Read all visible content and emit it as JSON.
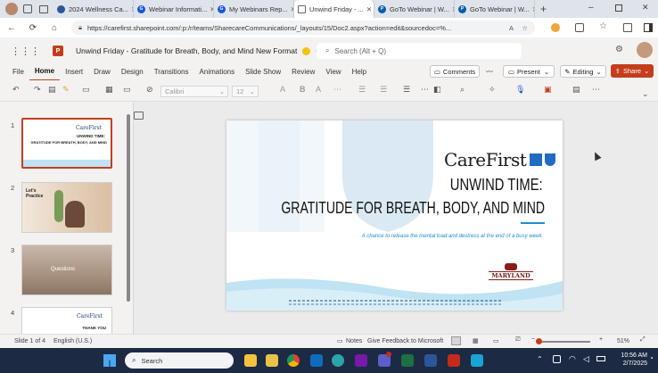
{
  "browser": {
    "tabs": [
      {
        "label": "2024 Wellness Ca...",
        "color": "#2b579a"
      },
      {
        "label": "Webinar Informati...",
        "color": "#1a56db"
      },
      {
        "label": "My Webinars Rep...",
        "color": "#1a56db"
      },
      {
        "label": "Unwind Friday - ...",
        "color": "#c43e1c",
        "active": true
      },
      {
        "label": "GoTo Webinar | W...",
        "color": "#0b5cad"
      },
      {
        "label": "GoTo Webinar | W...",
        "color": "#0b5cad"
      }
    ],
    "url": "https://carefirst.sharepoint.com/:p:/r/teams/SharecareCommunications/_layouts/15/Doc2.aspx?action=edit&sourcedoc=%..."
  },
  "ppt": {
    "doc_title": "Unwind Friday - Gratitude for Breath, Body, and Mind New Format",
    "search_placeholder": "Search (Alt + Q)",
    "menu": [
      "File",
      "Home",
      "Insert",
      "Draw",
      "Design",
      "Transitions",
      "Animations",
      "Slide Show",
      "Review",
      "View",
      "Help"
    ],
    "comments_label": "Comments",
    "present_label": "Present",
    "editing_label": "Editing",
    "share_label": "Share",
    "font_name": "Calibri",
    "font_size": "12"
  },
  "thumbnails": [
    {
      "num": "1",
      "line1": "UNWIND TIME:",
      "line2": "GRATITUDE FOR BREATH, BODY, AND MIND",
      "brand": "CareFirst"
    },
    {
      "num": "2",
      "label": "Let's Practice"
    },
    {
      "num": "3",
      "label": "Questions"
    },
    {
      "num": "4",
      "brand": "CareFirst",
      "label": "THANK YOU"
    }
  ],
  "slide": {
    "brand": "CareFirst",
    "title1": "UNWIND TIME:",
    "title2": "GRATITUDE FOR BREATH, BODY, AND MIND",
    "subtitle": "A chance to release the mental load and destress at the end of a busy week.",
    "badge": "MARYLAND"
  },
  "status": {
    "slide_info": "Slide 1 of 4",
    "language": "English (U.S.)",
    "notes": "Notes",
    "feedback": "Give Feedback to Microsoft",
    "zoom": "51%"
  },
  "taskbar": {
    "search": "Search",
    "time": "10:56 AM",
    "date": "2/7/2025"
  }
}
